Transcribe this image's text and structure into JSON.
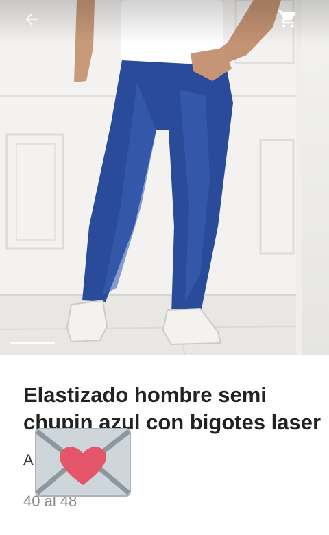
{
  "product": {
    "title": "Elastizado hombre semi chupin azul con bigotes laser",
    "meta_letter": "A",
    "sizes": "40 al 48"
  },
  "gallery": {
    "indicator_count": 1
  },
  "icons": {
    "back": "arrow-left-icon",
    "cart": "shopping-cart-icon",
    "sticker": "love-letter-icon"
  },
  "colors": {
    "denim": "#2a4b9a",
    "heart": "#e5566b",
    "envelope": "#cfd6db"
  }
}
